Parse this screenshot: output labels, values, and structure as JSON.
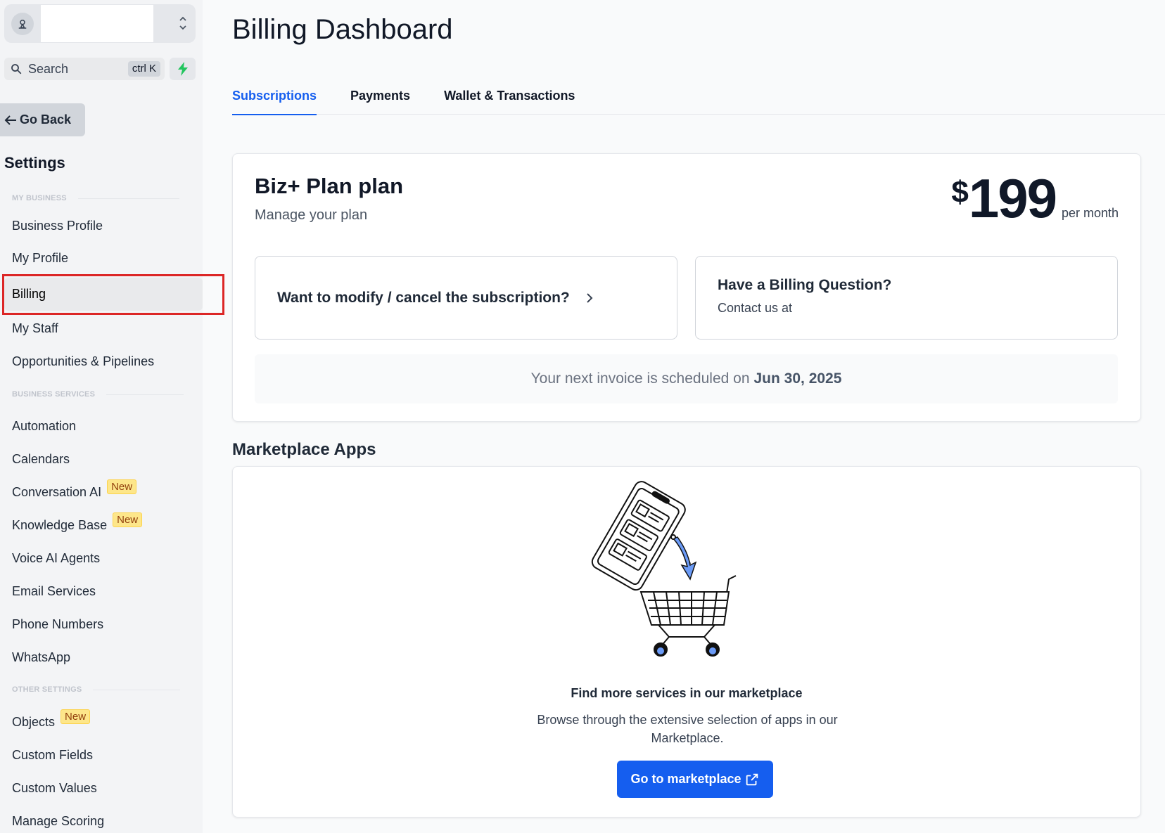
{
  "sidebar": {
    "search_label": "Search",
    "search_shortcut": "ctrl K",
    "go_back": "Go Back",
    "settings_title": "Settings",
    "section_my_business": "MY BUSINESS",
    "section_business_services": "BUSINESS SERVICES",
    "section_other_settings": "OTHER SETTINGS",
    "items": [
      {
        "label": "Business Profile"
      },
      {
        "label": "My Profile"
      },
      {
        "label": "Billing",
        "active": true
      },
      {
        "label": "My Staff"
      },
      {
        "label": "Opportunities & Pipelines"
      },
      {
        "label": "Automation"
      },
      {
        "label": "Calendars"
      },
      {
        "label": "Conversation AI",
        "badge": "New"
      },
      {
        "label": "Knowledge Base",
        "badge": "New"
      },
      {
        "label": "Voice AI Agents"
      },
      {
        "label": "Email Services"
      },
      {
        "label": "Phone Numbers"
      },
      {
        "label": "WhatsApp"
      },
      {
        "label": "Objects",
        "badge": "New"
      },
      {
        "label": "Custom Fields"
      },
      {
        "label": "Custom Values"
      },
      {
        "label": "Manage Scoring"
      }
    ]
  },
  "main": {
    "title": "Billing Dashboard",
    "tabs": [
      {
        "label": "Subscriptions",
        "active": true
      },
      {
        "label": "Payments"
      },
      {
        "label": "Wallet & Transactions"
      }
    ],
    "plan": {
      "name": "Biz+ Plan plan",
      "subtitle": "Manage your plan",
      "currency": "$",
      "amount": "199",
      "period": "per month",
      "modify_text": "Want to modify / cancel the subscription?",
      "question_title": "Have a Billing Question?",
      "question_sub": "Contact us at",
      "invoice_text": "Your next invoice is scheduled on",
      "invoice_date": "Jun 30, 2025"
    },
    "marketplace": {
      "heading": "Marketplace Apps",
      "title": "Find more services in our marketplace",
      "description": "Browse through the extensive selection of apps in our Marketplace.",
      "button": "Go to marketplace"
    }
  },
  "colors": {
    "accent": "#155eef",
    "highlight": "#dc2626",
    "badge_bg": "#fde68a",
    "bolt": "#22c55e"
  }
}
